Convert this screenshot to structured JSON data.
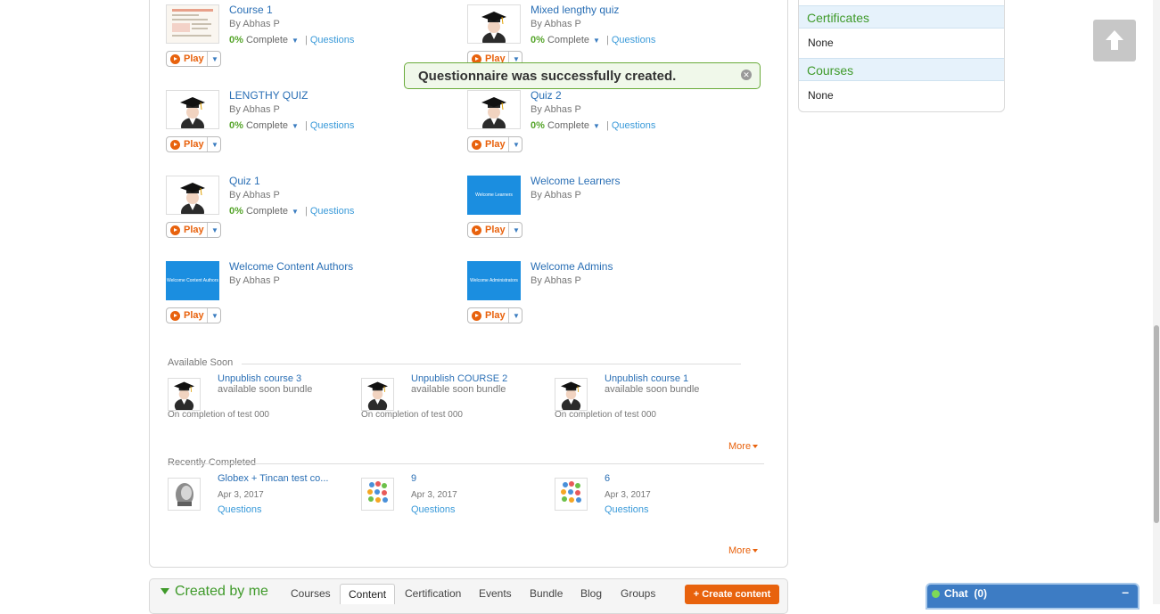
{
  "courses": [
    {
      "title": "Course 1",
      "by": "By Abhas P",
      "progress": "0%",
      "status": "Complete",
      "questions": "Questions",
      "thumb": "document-thumbnail",
      "play": "Play"
    },
    {
      "title": "Mixed lengthy quiz",
      "by": "By Abhas P",
      "progress": "0%",
      "status": "Complete",
      "questions": "Questions",
      "thumb": "graduate-avatar",
      "play": "Play"
    },
    {
      "title": "LENGTHY QUIZ",
      "by": "By Abhas P",
      "progress": "0%",
      "status": "Complete",
      "questions": "Questions",
      "thumb": "graduate-avatar",
      "play": "Play"
    },
    {
      "title": "Quiz 2",
      "by": "By Abhas P",
      "progress": "0%",
      "status": "Complete",
      "questions": "Questions",
      "thumb": "graduate-avatar",
      "play": "Play"
    },
    {
      "title": "Quiz 1",
      "by": "By Abhas P",
      "progress": "0%",
      "status": "Complete",
      "questions": "Questions",
      "thumb": "graduate-avatar",
      "play": "Play"
    },
    {
      "title": "Welcome Learners",
      "by": "By Abhas P",
      "thumb_text": "Welcome Learners",
      "play": "Play"
    },
    {
      "title": "Welcome Content Authors",
      "by": "By Abhas P",
      "thumb_text": "Welcome Content Authors",
      "play": "Play"
    },
    {
      "title": "Welcome Admins",
      "by": "By Abhas P",
      "thumb_text": "Welcome Administrators",
      "play": "Play"
    }
  ],
  "toast": {
    "message": "Questionnaire was successfully created."
  },
  "available_soon": {
    "heading": "Available Soon",
    "items": [
      {
        "title": "Unpublish course 3",
        "subtitle": "available soon bundle",
        "condition": "On completion of test 000"
      },
      {
        "title": "Unpublish COURSE 2",
        "subtitle": "available soon bundle",
        "condition": "On completion of test 000"
      },
      {
        "title": "Unpublish course 1",
        "subtitle": "available soon bundle",
        "condition": "On completion of test 000"
      }
    ],
    "more": "More"
  },
  "recently_completed": {
    "heading": "Recently Completed",
    "items": [
      {
        "title": "Globex + Tincan test co...",
        "date": "Apr 3, 2017",
        "questions": "Questions",
        "thumb": "helmet-icon"
      },
      {
        "title": "9",
        "date": "Apr 3, 2017",
        "questions": "Questions",
        "thumb": "bubbles-icon"
      },
      {
        "title": "6",
        "date": "Apr 3, 2017",
        "questions": "Questions",
        "thumb": "bubbles-icon"
      }
    ],
    "more": "More"
  },
  "sidebar": {
    "certificates_label": "Certificates",
    "certificates_value": "None",
    "courses_label": "Courses",
    "courses_value": "None"
  },
  "created_by_me": {
    "title": "Created by me",
    "tabs": [
      "Courses",
      "Content",
      "Certification",
      "Events",
      "Bundle",
      "Blog",
      "Groups"
    ],
    "active_tab": "Content",
    "create_button": "+ Create content"
  },
  "chat": {
    "label": "Chat",
    "count": "(0)",
    "minimize": "–"
  },
  "colors": {
    "accent_orange": "#e8620d",
    "link_blue": "#2a6fb5",
    "green": "#3f9a2a",
    "chat_blue": "#3d7cc4"
  }
}
